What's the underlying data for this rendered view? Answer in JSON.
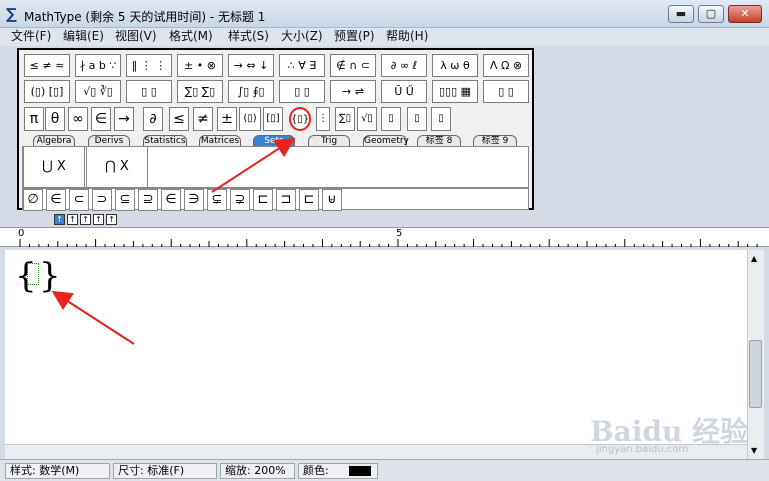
{
  "window": {
    "title": "MathType (剩余 5 天的试用时间) - 无标题 1",
    "min": "▬",
    "max": "▢",
    "close": "✕"
  },
  "menu": [
    "文件(F)",
    "编辑(E)",
    "视图(V)",
    "格式(M)",
    "样式(S)",
    "大小(Z)",
    "预置(P)",
    "帮助(H)"
  ],
  "palette_row1": [
    "≤ ≠ ≈",
    "∤ a b ∵",
    "‖ ⋮ ⋮",
    "± • ⊗",
    "→ ⇔ ↓",
    "∴ ∀ ∃",
    "∉ ∩ ⊂",
    "∂ ∞ ℓ",
    "λ ω θ",
    "Λ Ω ⊗"
  ],
  "palette_row2": [
    "(▯) [▯]",
    "√▯ ∛▯",
    "▯ ▯",
    "∑▯ ∑▯",
    "∫▯ ∮▯",
    "▯ ▯",
    "→ ⇌",
    "Ū Ű",
    "▯▯▯ ▦",
    "▯ ▯"
  ],
  "palette_row3": [
    "π",
    "θ",
    "∞",
    "∈",
    "→",
    "∂",
    "≤",
    "≠",
    "±",
    "(▯)",
    "[▯]",
    "{▯}",
    "⋮",
    "∑▯",
    "√▯",
    "▯",
    "▯",
    "▯"
  ],
  "tabs": [
    "Algebra",
    "Derivs",
    "Statistics",
    "Matrices",
    "Sets",
    "Trig",
    "Geometry",
    "标签 8",
    "标签 9"
  ],
  "templates": [
    "⋃ X",
    "⋂ X"
  ],
  "set_symbols": [
    "∅",
    "∈",
    "⊂",
    "⊃",
    "⊆",
    "⊇",
    "∈",
    "∋",
    "⊊",
    "⊋",
    "⊏",
    "⊐",
    "⊏",
    "⊌"
  ],
  "ruler": {
    "start": "0",
    "mid": "5"
  },
  "editor": {
    "open_brace": "{",
    "close_brace": "}"
  },
  "status": {
    "style": "样式: 数学(M)",
    "size": "尺寸: 标准(F)",
    "zoom": "缩放: 200%",
    "color_label": "颜色:"
  },
  "watermark": {
    "main": "Baidu 经验",
    "sub": "jingyan.baidu.com"
  },
  "colors": {
    "arrow": "#e8221c",
    "highlight": "#e8221c",
    "selected_tab": "#3b82d6"
  }
}
